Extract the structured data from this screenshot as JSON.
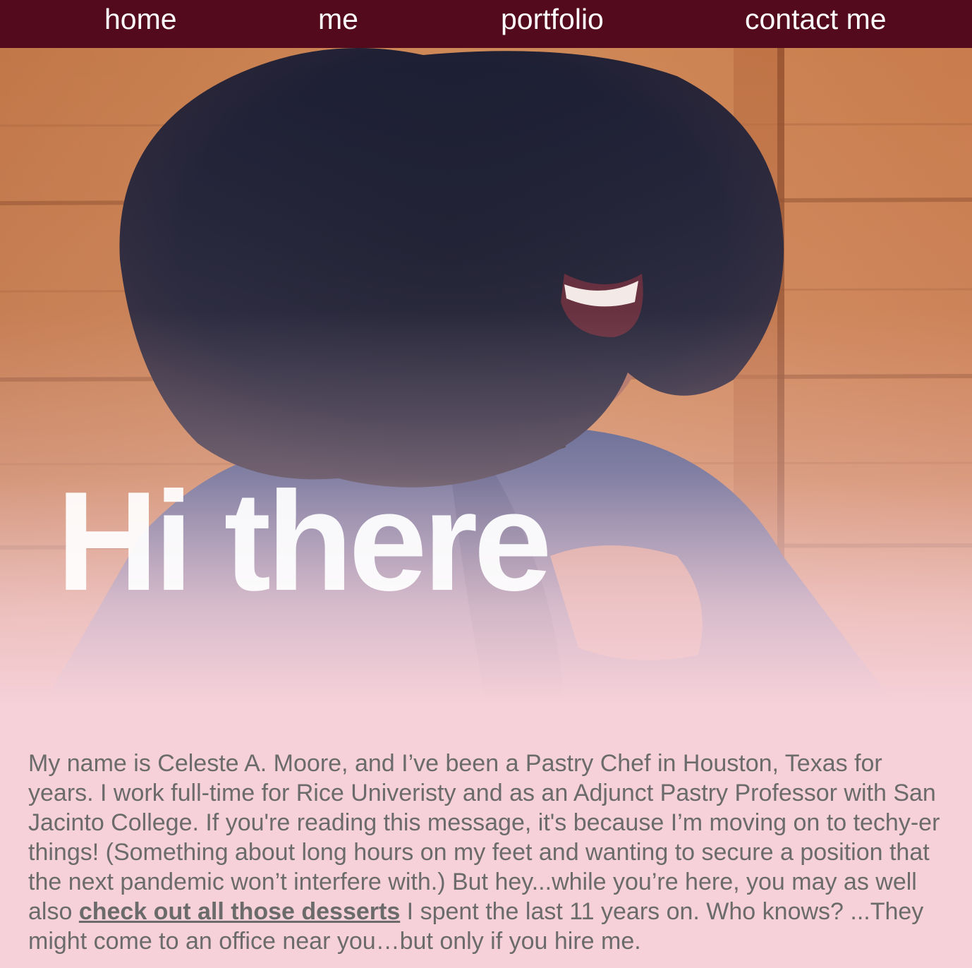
{
  "nav": {
    "items": [
      {
        "label": "home"
      },
      {
        "label": "me"
      },
      {
        "label": "portfolio"
      },
      {
        "label": "contact me"
      }
    ]
  },
  "hero": {
    "title": "Hi there"
  },
  "bio": {
    "text_before": "My name is Celeste A. Moore, and I’ve been a Pastry Chef in Houston, Texas for years. I work full-time for Rice Univeristy and as an Adjunct Pastry Professor with San Jacinto College. If you're reading this message, it's because I’m moving on to techy-er things! (Something about long hours on my feet and wanting to secure a position that the next pandemic won’t interfere with.) But hey...while you’re here, you may as well also ",
    "link_text": "check out all those desserts",
    "text_after": " I spent the last 11 years on. Who knows? ...They might come to an office near you…but only if you hire me."
  },
  "colors": {
    "nav_background": "#520a1c",
    "page_background": "#f6d1d9",
    "body_text": "#6b6b6b",
    "title_text": "#ffffff"
  }
}
